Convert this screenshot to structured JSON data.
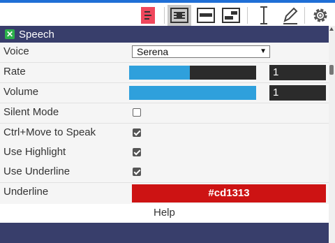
{
  "accent_color": "#1f6fd6",
  "panel_color": "#383e6b",
  "toolbar": {
    "icons": [
      "toc-icon",
      "align-center-icon",
      "align-full-icon",
      "align-right-icon",
      "text-cursor-icon",
      "pen-icon",
      "gear-icon"
    ]
  },
  "panel": {
    "title": "Speech",
    "close_icon": "close-icon",
    "close_color": "#2bb04a"
  },
  "rows": {
    "voice": {
      "label": "Voice",
      "value": "Serena"
    },
    "rate": {
      "label": "Rate",
      "value": "1",
      "level_fraction": 0.48
    },
    "volume": {
      "label": "Volume",
      "value": "1",
      "level_fraction": 1.0
    },
    "silent_mode": {
      "label": "Silent Mode",
      "checked": false
    },
    "ctrl_move": {
      "label": "Ctrl+Move to Speak",
      "checked": true
    },
    "use_highlight": {
      "label": "Use Highlight",
      "checked": true
    },
    "use_underline": {
      "label": "Use Underline",
      "checked": true
    },
    "underline": {
      "label": "Underline",
      "value": "#cd1313",
      "color": "#cd1313"
    }
  },
  "help_label": "Help"
}
